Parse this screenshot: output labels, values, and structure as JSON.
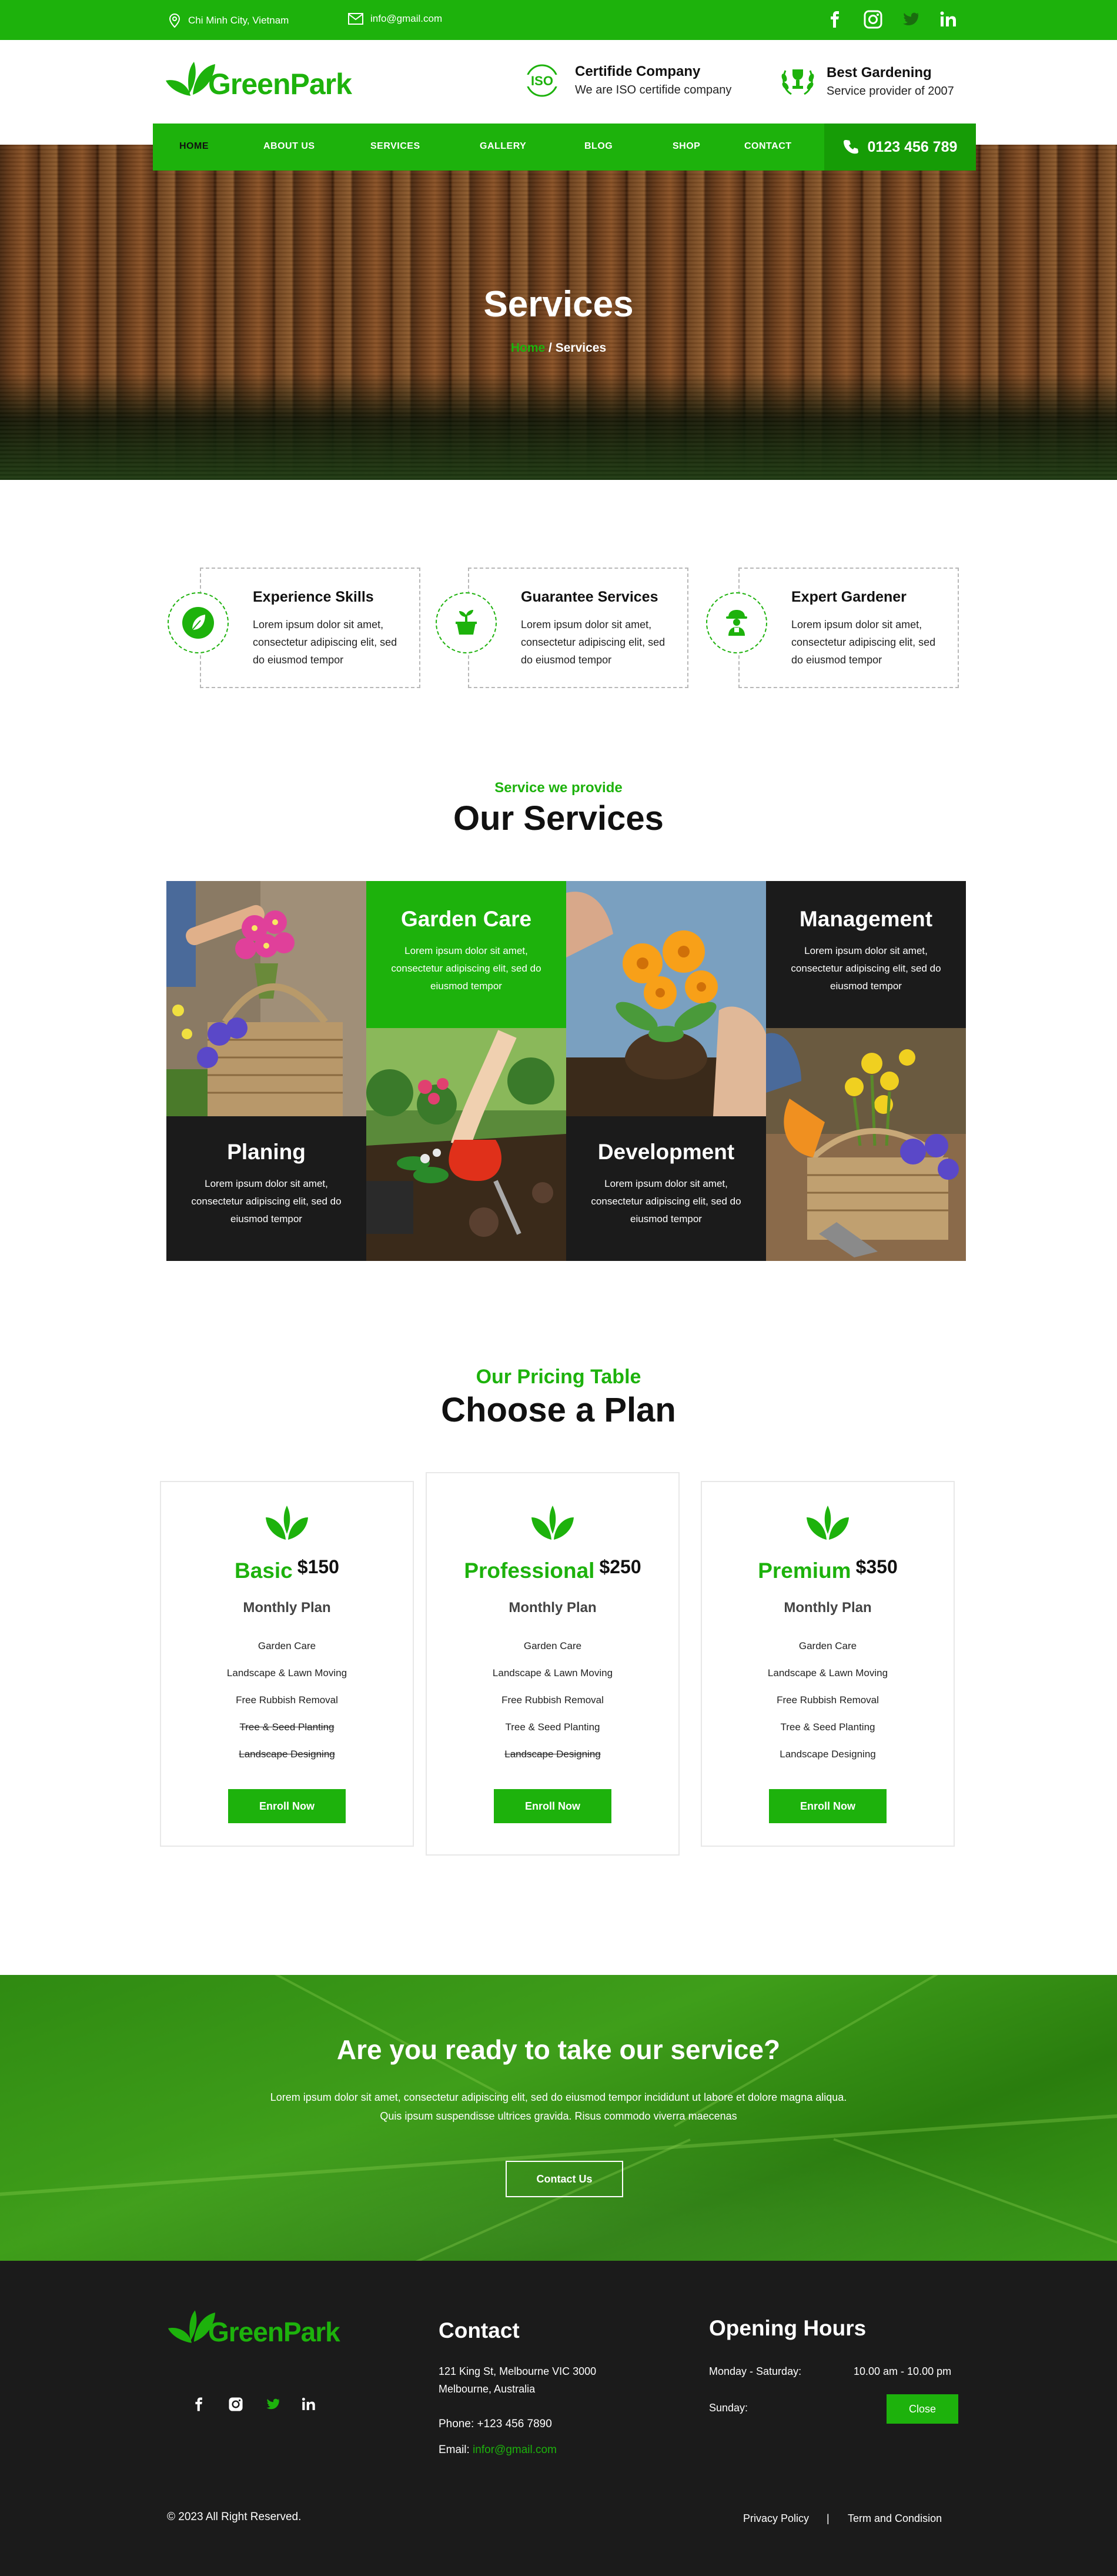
{
  "topbar": {
    "location": "Chi Minh City, Vietnam",
    "email": "info@gmail.com",
    "social": [
      "facebook-icon",
      "instagram-icon",
      "twitter-icon",
      "linkedin-icon"
    ]
  },
  "header": {
    "logo_text": "GreenPark",
    "certified_title": "Certifide Company",
    "certified_sub": "We are ISO certifide company",
    "iso_label": "ISO",
    "best_title": "Best Gardening",
    "best_sub": "Service provider of 2007"
  },
  "nav": {
    "items": [
      "HOME",
      "ABOUT US",
      "SERVICES",
      "GALLERY",
      "BLOG",
      "SHOP",
      "CONTACT"
    ],
    "phone": "0123 456 789"
  },
  "hero": {
    "title": "Services",
    "crumb_home": "Home",
    "crumb_sep": " / ",
    "crumb_current": "Services"
  },
  "features": [
    {
      "title": "Experience Skills",
      "text": "Lorem ipsum dolor sit amet, consectetur adipiscing elit, sed do eiusmod tempor",
      "icon": "leaf-icon"
    },
    {
      "title": "Guarantee Services",
      "text": "Lorem ipsum dolor sit amet, consectetur adipiscing elit, sed do eiusmod tempor",
      "icon": "plant-pot-icon"
    },
    {
      "title": "Expert Gardener",
      "text": "Lorem ipsum dolor sit amet, consectetur adipiscing elit, sed do eiusmod tempor",
      "icon": "gardener-icon"
    }
  ],
  "services": {
    "subtitle": "Service we provide",
    "title": "Our Services",
    "cards": [
      {
        "title": "Garden Care",
        "text": "Lorem ipsum dolor sit amet, consectetur adipiscing elit, sed do eiusmod tempor"
      },
      {
        "title": "Management",
        "text": "Lorem ipsum dolor sit amet, consectetur adipiscing elit, sed do eiusmod tempor"
      },
      {
        "title": "Planing",
        "text": "Lorem ipsum dolor sit amet, consectetur adipiscing elit, sed do eiusmod tempor"
      },
      {
        "title": "Development",
        "text": "Lorem ipsum dolor sit amet, consectetur adipiscing elit, sed do eiusmod tempor"
      }
    ]
  },
  "pricing": {
    "subtitle": "Our Pricing Table",
    "title": "Choose a Plan",
    "plans": [
      {
        "name": "Basic",
        "price": "$150",
        "period": "Monthly Plan",
        "button": "Enroll Now",
        "features": [
          "Garden Care",
          "Landscape & Lawn Moving",
          "Free Rubbish Removal",
          "Tree & Seed Planting",
          "Landscape Designing"
        ],
        "struck": [
          false,
          false,
          false,
          true,
          true
        ]
      },
      {
        "name": "Professional",
        "price": "$250",
        "period": "Monthly Plan",
        "button": "Enroll Now",
        "features": [
          "Garden Care",
          "Landscape & Lawn Moving",
          "Free Rubbish Removal",
          "Tree & Seed Planting",
          "Landscape Designing"
        ],
        "struck": [
          false,
          false,
          false,
          false,
          true
        ]
      },
      {
        "name": "Premium",
        "price": "$350",
        "period": "Monthly Plan",
        "button": "Enroll Now",
        "features": [
          "Garden Care",
          "Landscape & Lawn Moving",
          "Free Rubbish Removal",
          "Tree & Seed Planting",
          "Landscape Designing"
        ],
        "struck": [
          false,
          false,
          false,
          false,
          false
        ]
      }
    ]
  },
  "cta": {
    "title": "Are you ready to take our service?",
    "text": "Lorem ipsum dolor sit amet, consectetur adipiscing elit, sed do eiusmod tempor incididunt ut labore et dolore magna aliqua. Quis ipsum suspendisse ultrices gravida. Risus commodo viverra maecenas",
    "button": "Contact Us"
  },
  "footer": {
    "logo_text": "GreenPark",
    "contact_title": "Contact",
    "address_line1": "121 King St, Melbourne VIC 3000",
    "address_line2": "Melbourne, Australia",
    "phone": "Phone: +123 456 7890",
    "email_label": "Email: ",
    "email": "infor@gmail.com",
    "hours_title": "Opening Hours",
    "weekday_label": "Monday - Saturday:",
    "weekday_hours": "10.00 am - 10.00 pm",
    "sunday_label": "Sunday:",
    "sunday_status": "Close",
    "copyright": "© 2023 All Right Reserved.",
    "privacy": "Privacy Policy",
    "separator": "|",
    "terms": "Term and Condision"
  },
  "colors": {
    "brand_green": "#1db20c",
    "dark": "#1b1b1b"
  }
}
